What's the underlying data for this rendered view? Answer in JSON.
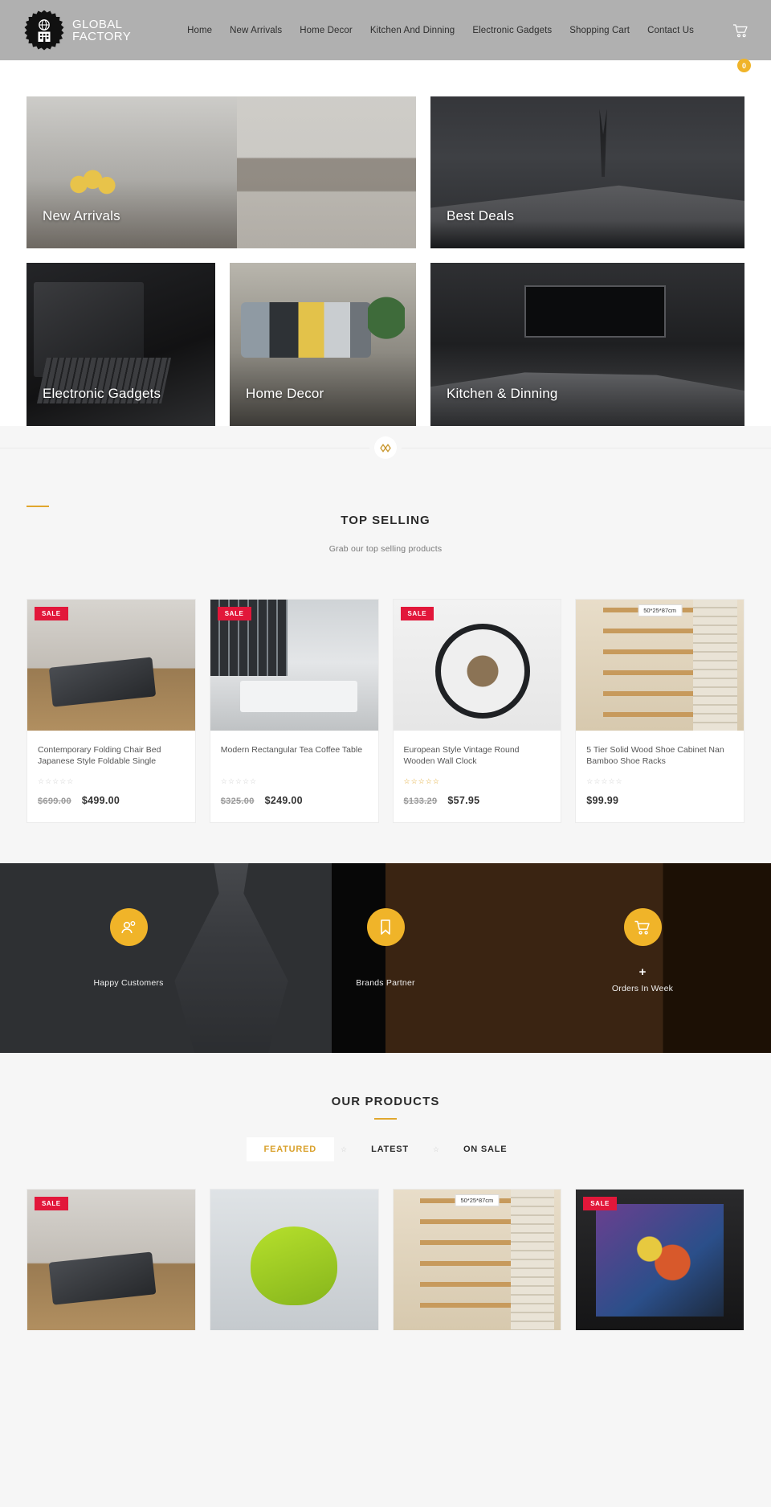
{
  "header": {
    "brand_line1": "GLOBAL",
    "brand_line2": "FACTORY",
    "nav": [
      {
        "label": "Home"
      },
      {
        "label": "New Arrivals"
      },
      {
        "label": "Home Decor"
      },
      {
        "label": "Kitchen And Dinning"
      },
      {
        "label": "Electronic Gadgets"
      },
      {
        "label": "Shopping Cart"
      },
      {
        "label": "Contact Us"
      }
    ],
    "cart_count": "0",
    "background_color": "#b0b0b0"
  },
  "categories": {
    "row1": [
      {
        "label": "New Arrivals"
      },
      {
        "label": "Best Deals"
      }
    ],
    "row2": [
      {
        "label": "Electronic Gadgets"
      },
      {
        "label": "Home Decor"
      },
      {
        "label": "Kitchen & Dinning"
      }
    ]
  },
  "top_selling": {
    "title": "TOP SELLING",
    "subtitle": "Grab our top selling products",
    "products": [
      {
        "title": "Contemporary Folding Chair Bed Japanese Style Foldable Single",
        "badge": "SALE",
        "stars": "☆☆☆☆☆",
        "rated": false,
        "price_old": "$699.00",
        "price_new": "$499.00"
      },
      {
        "title": "Modern Rectangular Tea Coffee Table",
        "badge": "SALE",
        "stars": "☆☆☆☆☆",
        "rated": false,
        "price_old": "$325.00",
        "price_new": "$249.00"
      },
      {
        "title": "European Style Vintage Round Wooden Wall Clock",
        "badge": "SALE",
        "stars": "☆☆☆☆☆",
        "rated": true,
        "price_old": "$133.29",
        "price_new": "$57.95"
      },
      {
        "title": "5 Tier Solid Wood Shoe Cabinet Nan Bamboo Shoe Racks",
        "badge": "",
        "size_tag": "50*25*87cm",
        "stars": "☆☆☆☆☆",
        "rated": false,
        "price_old": "",
        "price_new": "$99.99"
      }
    ]
  },
  "stats": [
    {
      "icon": "people-icon",
      "count": "",
      "label": "Happy Customers"
    },
    {
      "icon": "bookmark-icon",
      "count": "",
      "label": "Brands Partner"
    },
    {
      "icon": "cart-icon",
      "count": "+",
      "label": "Orders In Week"
    }
  ],
  "our_products": {
    "title": "OUR PRODUCTS",
    "tabs": [
      {
        "label": "FEATURED",
        "active": true
      },
      {
        "label": "LATEST",
        "active": false
      },
      {
        "label": "ON SALE",
        "active": false
      }
    ],
    "products": [
      {
        "badge": "SALE",
        "size_tag": ""
      },
      {
        "badge": "",
        "size_tag": ""
      },
      {
        "badge": "",
        "size_tag": "50*25*87cm"
      },
      {
        "badge": "SALE",
        "size_tag": ""
      }
    ]
  },
  "colors": {
    "accent": "#e0a72e",
    "sale": "#e2173a",
    "header_bg": "#b0b0b0",
    "page_bg": "#f6f6f6"
  }
}
